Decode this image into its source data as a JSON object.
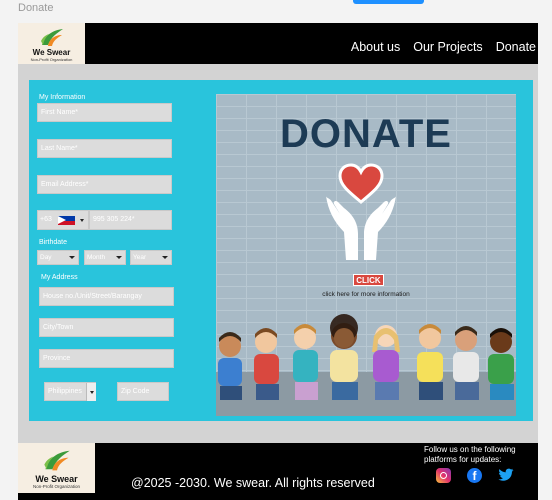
{
  "frame": {
    "label": "Donate"
  },
  "header": {
    "logo": {
      "name": "We Swear",
      "tagline": "Non-Profit Organization"
    },
    "nav": [
      {
        "label": "About us"
      },
      {
        "label": "Our Projects"
      },
      {
        "label": "Donate"
      }
    ]
  },
  "form": {
    "sections": {
      "info": "My Information",
      "birthdate": "Birthdate",
      "address": "My Address"
    },
    "fields": {
      "first_name": "First Name*",
      "last_name": "Last Name*",
      "email": "Email Address*",
      "phone_prefix": "+63",
      "phone": "995 305 224*",
      "day": "Day",
      "month": "Month",
      "year": "Year",
      "house": "House no./Unit/Street/Barangay",
      "city": "City/Town",
      "province": "Province",
      "country": "Philippines",
      "zip": "Zip Code"
    }
  },
  "banner": {
    "title": "DONATE",
    "button": "CLICK",
    "info": "click here for more information"
  },
  "footer": {
    "follow": "Follow us on the following platforms for updates:",
    "copyright": "@2025 -2030. We swear. All rights reserved",
    "socials": [
      {
        "icon": "instagram-icon"
      },
      {
        "icon": "facebook-icon"
      },
      {
        "icon": "twitter-icon"
      }
    ]
  },
  "colors": {
    "panel": "#29c4dc",
    "header": "#000000",
    "accent": "#d9483f",
    "title": "#1d3b55"
  }
}
